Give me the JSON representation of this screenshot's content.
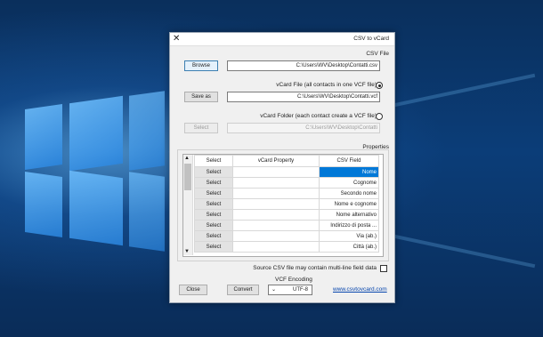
{
  "window": {
    "title": "CSV to vCard",
    "close_glyph": "✕"
  },
  "csv": {
    "group_label": "CSV File",
    "browse": "Browse",
    "path": "C:\\Users\\WV\\Desktop\\Contatti.csv"
  },
  "vcard_one": {
    "label": "vCard File (all contacts in one VCF file)",
    "save_as": "Save as",
    "path": "C:\\Users\\WV\\Desktop\\Contatti.vcf"
  },
  "vcard_folder": {
    "label": "vCard Folder (each contact create a VCF file)",
    "select": "Select",
    "path": "C:\\Users\\WV\\Desktop\\Contatti"
  },
  "properties": {
    "group_label": "Properties",
    "headers": {
      "field": "CSV Field",
      "property": "vCard Property",
      "select": "Select"
    },
    "rows": [
      {
        "field": "Nome",
        "select": "Select"
      },
      {
        "field": "Cognome",
        "select": "Select"
      },
      {
        "field": "Secondo nome",
        "select": "Select"
      },
      {
        "field": "Nome e cognome",
        "select": "Select"
      },
      {
        "field": "Nome alternativo",
        "select": "Select"
      },
      {
        "field": "Indirizzo di posta ...",
        "select": "Select"
      },
      {
        "field": "Via (ab.)",
        "select": "Select"
      },
      {
        "field": "Città (ab.)",
        "select": "Select"
      }
    ]
  },
  "multiline": {
    "label": "Source CSV file may contain multi-line field data",
    "checked": false
  },
  "encoding": {
    "label": "VCF Encoding",
    "value": "UTF-8"
  },
  "footer": {
    "convert": "Convert",
    "close": "Close",
    "link": "www.csvtovcard.com"
  }
}
